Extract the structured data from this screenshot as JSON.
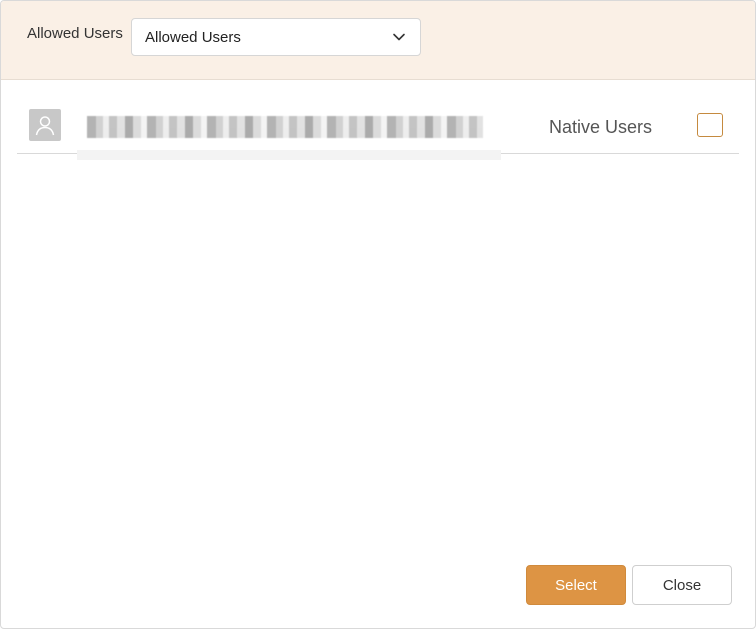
{
  "filter": {
    "label": "Allowed Users",
    "selected_value": "Allowed Users"
  },
  "users": [
    {
      "name": "████████████████████████████████",
      "type": "Native Users",
      "selected": false
    }
  ],
  "actions": {
    "select_label": "Select",
    "close_label": "Close"
  },
  "colors": {
    "header_background": "#faf0e6",
    "primary_button": "#dd9444",
    "checkbox_border": "#c58a3f",
    "avatar_background": "#c8c8c8"
  },
  "icons": {
    "avatar": "user-silhouette-icon",
    "dropdown": "chevron-down-icon"
  }
}
